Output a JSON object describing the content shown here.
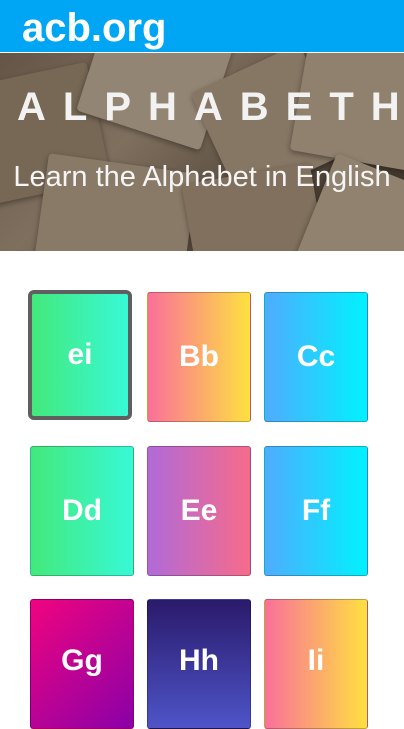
{
  "header": {
    "site_name": "acb.org"
  },
  "hero": {
    "title": "ALPHABETH",
    "subtitle": "Learn the Alphabet in English"
  },
  "letters": [
    {
      "label": "ei",
      "selected": true
    },
    {
      "label": "Bb",
      "selected": false
    },
    {
      "label": "Cc",
      "selected": false
    },
    {
      "label": "Dd",
      "selected": false
    },
    {
      "label": "Ee",
      "selected": false
    },
    {
      "label": "Ff",
      "selected": false
    },
    {
      "label": "Gg",
      "selected": false
    },
    {
      "label": "Hh",
      "selected": false
    },
    {
      "label": "Ii",
      "selected": false
    }
  ],
  "colors": {
    "header_bg": "#00a6f3",
    "green": [
      "#43e97b",
      "#38f9d7"
    ],
    "pink_yellow": [
      "#fa709a",
      "#fee140"
    ],
    "blue": [
      "#4facfe",
      "#00f2fe"
    ],
    "purple_pink": [
      "#b06ad9",
      "#f76b8a"
    ],
    "magenta": [
      "#f0047f",
      "#8a00a8"
    ],
    "navy": [
      "#2a1a6b",
      "#4e54c8"
    ]
  }
}
